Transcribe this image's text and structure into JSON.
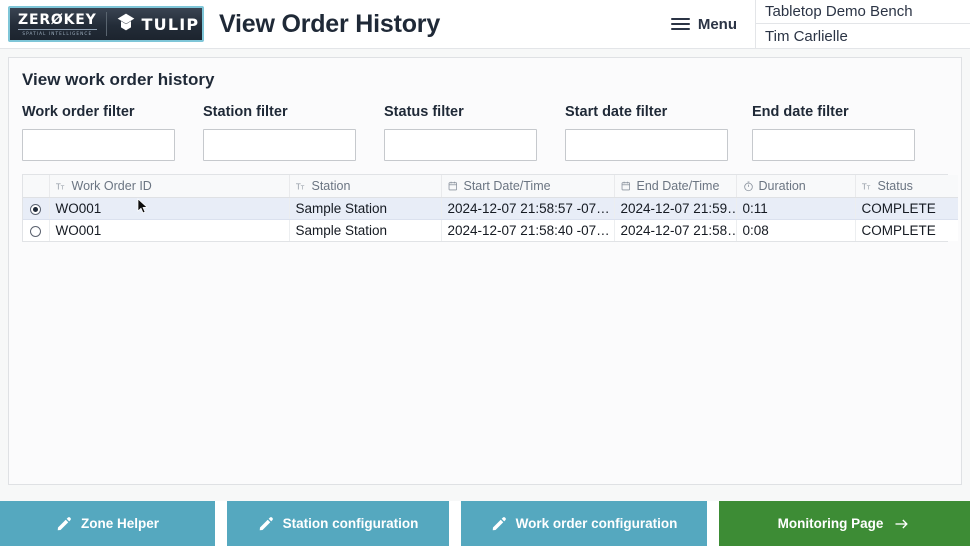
{
  "header": {
    "logo": {
      "zerokey_name": "ZERØKEY",
      "zerokey_tagline": "SPATIAL INTELLIGENCE",
      "tulip_name": "TULIP",
      "tulip_icon": "tulip-diamond-icon"
    },
    "title": "View Order History",
    "menu": {
      "label": "Menu",
      "icon": "hamburger-menu-icon"
    },
    "station_name": "Tabletop Demo Bench",
    "user_name": "Tim Carlielle"
  },
  "main": {
    "card_title": "View work order history",
    "filters": [
      {
        "label": "Work order filter",
        "value": "",
        "placeholder": ""
      },
      {
        "label": "Station filter",
        "value": "",
        "placeholder": ""
      },
      {
        "label": "Status filter",
        "value": "",
        "placeholder": ""
      },
      {
        "label": "Start date filter",
        "value": "",
        "placeholder": ""
      },
      {
        "label": "End date filter",
        "value": "",
        "placeholder": ""
      }
    ],
    "table": {
      "columns": [
        {
          "key": "select",
          "label": "",
          "icon": ""
        },
        {
          "key": "work_order_id",
          "label": "Work Order ID",
          "icon": "text-type-icon"
        },
        {
          "key": "station",
          "label": "Station",
          "icon": "text-type-icon"
        },
        {
          "key": "start_datetime",
          "label": "Start Date/Time",
          "icon": "calendar-icon"
        },
        {
          "key": "end_datetime",
          "label": "End Date/Time",
          "icon": "calendar-icon"
        },
        {
          "key": "duration",
          "label": "Duration",
          "icon": "clock-icon"
        },
        {
          "key": "status",
          "label": "Status",
          "icon": "text-type-icon"
        }
      ],
      "rows": [
        {
          "selected": true,
          "work_order_id": "WO001",
          "station": "Sample Station",
          "start_datetime": "2024-12-07 21:58:57 -07…",
          "end_datetime": "2024-12-07 21:59…",
          "duration": "0:11",
          "status": "COMPLETE"
        },
        {
          "selected": false,
          "work_order_id": "WO001",
          "station": "Sample Station",
          "start_datetime": "2024-12-07 21:58:40 -07…",
          "end_datetime": "2024-12-07 21:58…",
          "duration": "0:08",
          "status": "COMPLETE"
        }
      ]
    }
  },
  "footer": {
    "buttons": [
      {
        "label": "Zone Helper",
        "icon": "pencil-icon",
        "style": "teal"
      },
      {
        "label": "Station configuration",
        "icon": "pencil-icon",
        "style": "teal"
      },
      {
        "label": "Work order configuration",
        "icon": "pencil-icon",
        "style": "teal"
      },
      {
        "label": "Monitoring Page",
        "icon": "arrow-right-icon",
        "style": "green"
      }
    ]
  },
  "colors": {
    "teal_button": "#55a8bf",
    "green_button": "#3d8c35",
    "selected_row": "#e8edf7",
    "logo_border": "#7fc6d8",
    "text_dark": "#1f2937"
  }
}
